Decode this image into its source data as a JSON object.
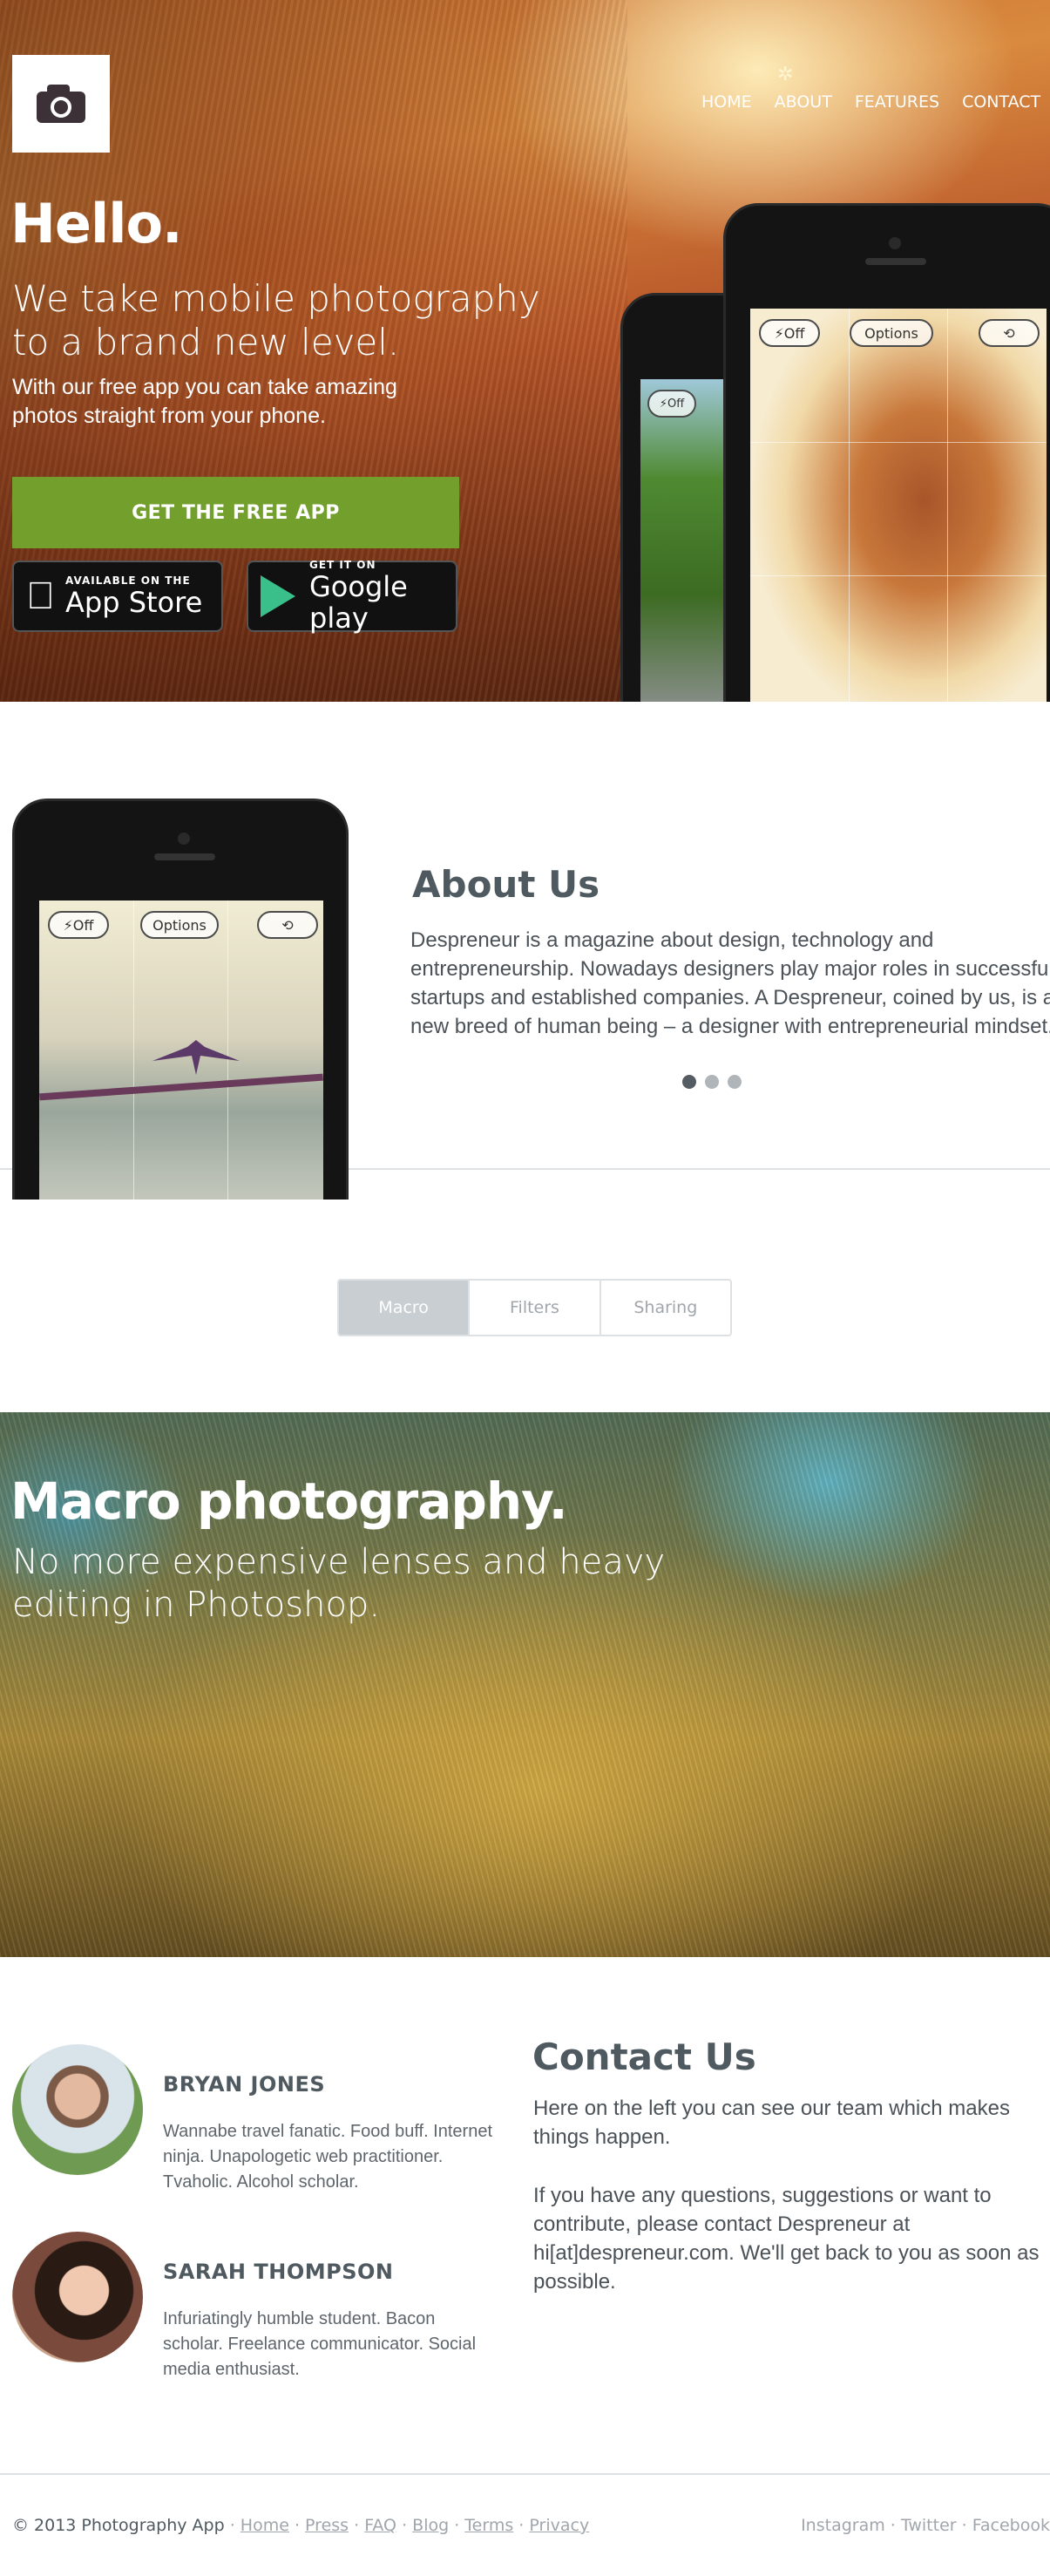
{
  "nav": {
    "items": [
      "HOME",
      "ABOUT",
      "FEATURES",
      "CONTACT"
    ]
  },
  "hero": {
    "title": "Hello.",
    "subtitle": "We take mobile photography to a brand new level.",
    "description": "With our free app you can take amazing photos straight from your phone.",
    "cta_label": "GET THE FREE APP",
    "app_store_small": "AVAILABLE ON THE",
    "app_store_big": "App Store",
    "google_play_small": "GET IT ON",
    "google_play_big": "Google play"
  },
  "camera_ui": {
    "flash_label": "Off",
    "options_label": "Options"
  },
  "about": {
    "title": "About Us",
    "text": "Despreneur is a magazine about design, technology and entrepreneurship. Nowadays designers play major roles in successful startups and established companies. A Despreneur, coined by us, is  a new breed of human being – a designer with entrepreneurial mindset."
  },
  "tabs": [
    "Macro",
    "Filters",
    "Sharing"
  ],
  "macro": {
    "title": "Macro photography.",
    "subtitle": "No more expensive lenses and heavy editing in Photoshop."
  },
  "team": [
    {
      "name": "BRYAN JONES",
      "bio": "Wannabe travel fanatic. Food buff. Internet ninja. Unapologetic web practitioner. Tvaholic. Alcohol scholar."
    },
    {
      "name": "SARAH THOMPSON",
      "bio": "Infuriatingly humble student. Bacon scholar. Freelance communicator. Social media enthusiast."
    }
  ],
  "contact": {
    "title": "Contact Us",
    "paragraph1": "Here on the left you can see our team which makes things happen.",
    "paragraph2": "If you have any questions, suggestions or want to contribute, please contact Despreneur at hi[at]despreneur.com. We'll get back to you as soon as possible."
  },
  "footer": {
    "copyright": "© 2013 Photography App",
    "links": [
      "Home",
      "Press",
      "FAQ",
      "Blog",
      "Terms",
      "Privacy"
    ],
    "social": [
      "Instagram",
      "Twitter",
      "Facebook"
    ],
    "separator": " · "
  },
  "colors": {
    "accent_green": "#73a02c",
    "heading": "#4f5960",
    "muted": "#a0a6ab"
  }
}
